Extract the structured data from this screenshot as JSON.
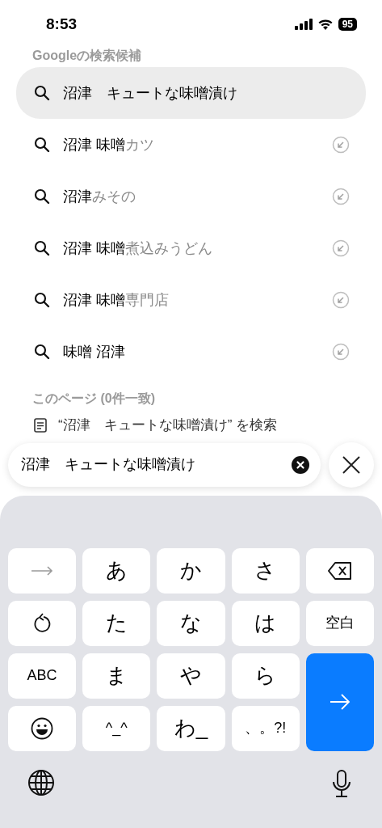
{
  "status_bar": {
    "time": "8:53",
    "battery": "95"
  },
  "suggestions_header": "Googleの検索候補",
  "suggestions": [
    {
      "kind": "typed",
      "query": "沼津　キュートな味噌漬け",
      "selected": true
    },
    {
      "kind": "suggestion",
      "query": "沼津 味噌",
      "completion": "カツ",
      "selected": false
    },
    {
      "kind": "suggestion",
      "query": "沼津",
      "completion": "みその",
      "selected": false
    },
    {
      "kind": "suggestion",
      "query": "沼津 味噌",
      "completion": "煮込みうどん",
      "selected": false
    },
    {
      "kind": "suggestion",
      "query": "沼津 味噌",
      "completion": "専門店",
      "selected": false
    },
    {
      "kind": "suggestion",
      "query": "味噌 沼津",
      "selected": false
    }
  ],
  "page_section": {
    "header": "このページ (0件一致)",
    "find_text": "“沼津　キュートな味噌漬け” を検索"
  },
  "search_field": {
    "value": "沼津　キュートな味噌漬け"
  },
  "keyboard": {
    "keys": [
      {
        "kind": "arrow",
        "disabled": true
      },
      {
        "kind": "text",
        "label": "あ"
      },
      {
        "kind": "text",
        "label": "か"
      },
      {
        "kind": "text",
        "label": "さ"
      },
      {
        "kind": "backspace"
      },
      {
        "kind": "undo"
      },
      {
        "kind": "text",
        "label": "た"
      },
      {
        "kind": "text",
        "label": "な"
      },
      {
        "kind": "text",
        "label": "は"
      },
      {
        "kind": "small",
        "label": "空白"
      },
      {
        "kind": "small",
        "label": "ABC"
      },
      {
        "kind": "text",
        "label": "ま"
      },
      {
        "kind": "text",
        "label": "や"
      },
      {
        "kind": "text",
        "label": "ら"
      },
      {
        "kind": "enter"
      },
      {
        "kind": "emoji"
      },
      {
        "kind": "small",
        "label": "^_^"
      },
      {
        "kind": "text",
        "label": "わ_"
      },
      {
        "kind": "small",
        "label": "、。?!"
      }
    ]
  }
}
